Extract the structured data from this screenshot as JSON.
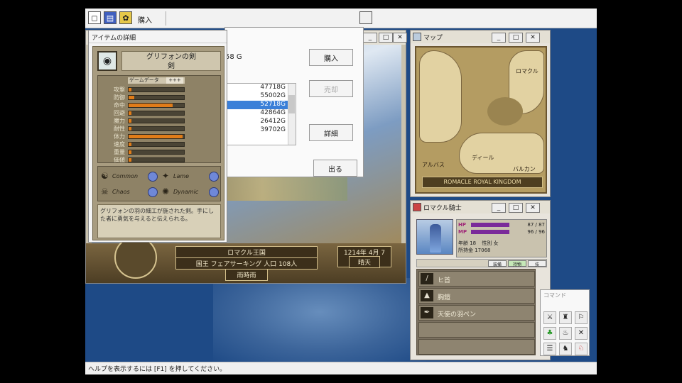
{
  "toolbar": {
    "buy_label": "購入",
    "icons": [
      "window-icon",
      "book-icon",
      "bag-icon"
    ]
  },
  "status_bar": {
    "help_text": "ヘルプを表示するには [F1] を押してください。"
  },
  "purchase_dialog": {
    "price_prefix": "58 G",
    "buttons": {
      "buy": "購入",
      "sell": "売却",
      "detail": "詳細",
      "exit": "出る"
    },
    "prices": [
      "47718G",
      "55002G",
      "52718G",
      "42864G",
      "26412G",
      "39702G"
    ],
    "selected_index": 2
  },
  "game_window": {
    "location_plaque": "ロマクル王国",
    "date_plaque": "1214年 4月 7日",
    "sub_plaque": "晴天",
    "ruler_plaque": "国王 フェアサーキング 人口 108人",
    "ruler_sub": "雨時雨"
  },
  "item_detail": {
    "title": "アイテムの詳細",
    "name": "グリフォンの剣",
    "subname": "剣",
    "stat_header": "ゲームデータ",
    "stat_header2": "+++",
    "stats": [
      {
        "label": "攻撃",
        "value": "",
        "fill": 0.05
      },
      {
        "label": "防御",
        "value": "",
        "fill": 0.1
      },
      {
        "label": "命中",
        "value": "",
        "fill": 0.8
      },
      {
        "label": "回避",
        "value": "",
        "fill": 0.05
      },
      {
        "label": "魔力",
        "value": "",
        "fill": 0.05
      },
      {
        "label": "耐性",
        "value": "",
        "fill": 0.05
      },
      {
        "label": "体力",
        "value": "",
        "fill": 0.98
      },
      {
        "label": "速度",
        "value": "",
        "fill": 0.05
      },
      {
        "label": "重量",
        "value": "",
        "fill": 0.05
      },
      {
        "label": "価値",
        "value": "",
        "fill": 0.05
      }
    ],
    "elements": [
      {
        "label": "Common",
        "glyph": "☯"
      },
      {
        "label": "Lame",
        "glyph": "✦"
      },
      {
        "label": "Chaos",
        "glyph": "☠"
      },
      {
        "label": "Dynamic",
        "glyph": "✺"
      }
    ],
    "description": "グリフォンの羽の細工が施された剣。手にした者に勇気を与えると伝えられる。"
  },
  "map_window": {
    "title": "マップ",
    "labels": [
      "ロマクル",
      "アルバス",
      "ディール",
      "バルカン"
    ],
    "plate": "ROMACLE ROYAL KINGDOM"
  },
  "char_window": {
    "title": "ロマクル騎士",
    "hp_label": "HP",
    "hp_value": "87 / 87",
    "hp_fill": 1.0,
    "mp_label": "MP",
    "mp_value": "96 / 96",
    "mp_fill": 1.0,
    "info": [
      "年齢 18",
      "性別 女",
      "所持金 17068"
    ],
    "tabs": [
      "装備",
      "持物",
      "技",
      "能力"
    ],
    "items": [
      {
        "name": "ヒ首",
        "glyph": "/"
      },
      {
        "name": "胸鎧",
        "glyph": "▲"
      },
      {
        "name": "天使の羽ペン",
        "glyph": "✒"
      }
    ]
  },
  "actions": {
    "title": "コマンド",
    "icons": [
      "⚔",
      "♜",
      "⚐",
      "♣",
      "♨",
      "✕",
      "☰",
      "♞",
      "♘"
    ]
  }
}
